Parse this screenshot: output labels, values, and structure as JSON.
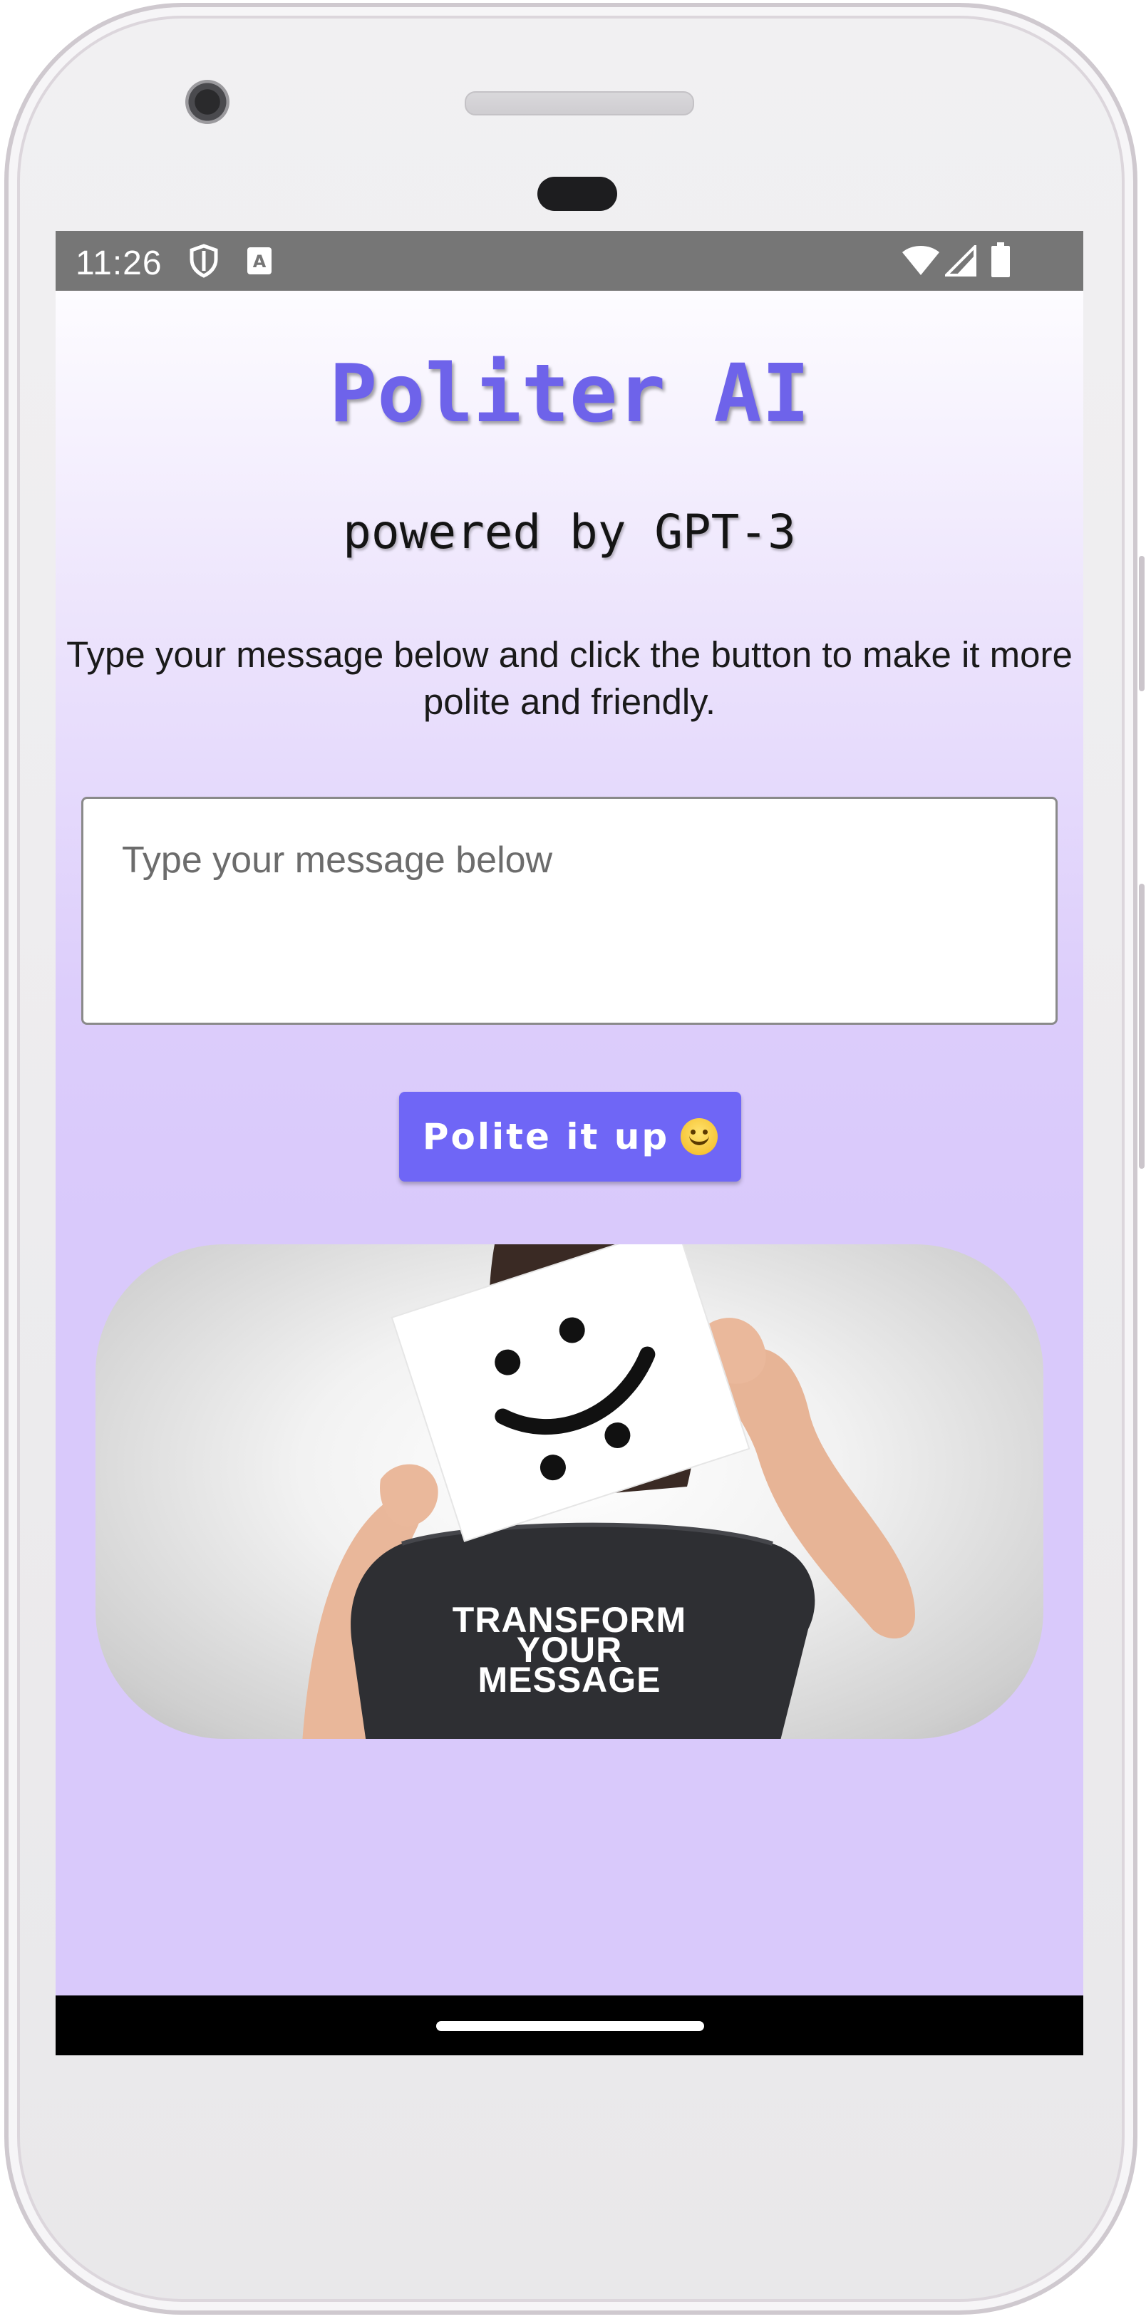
{
  "status_bar": {
    "time": "11:26",
    "left_icons": [
      "shield-icon",
      "keyboard-a-icon"
    ],
    "right_icons": [
      "wifi-icon",
      "cell-signal-icon",
      "battery-icon"
    ]
  },
  "app": {
    "title": "Politer AI",
    "subtitle": "powered by GPT-3",
    "instructions": "Type your message below and click the button to make it more polite and friendly.",
    "message_input": {
      "value": "",
      "placeholder": "Type your message below"
    },
    "submit_button": {
      "label": "Polite it up",
      "emoji_icon": "smiling-face-icon"
    },
    "hero_image": {
      "caption_lines": [
        "TRANSFORM",
        "YOUR",
        "MESSAGE"
      ],
      "description_icon": "smiley-sign-photo"
    }
  },
  "colors": {
    "title": "#6e63ea",
    "button": "#6f66f6",
    "background_bottom": "#d9c9fb",
    "status_bar": "#767676"
  }
}
